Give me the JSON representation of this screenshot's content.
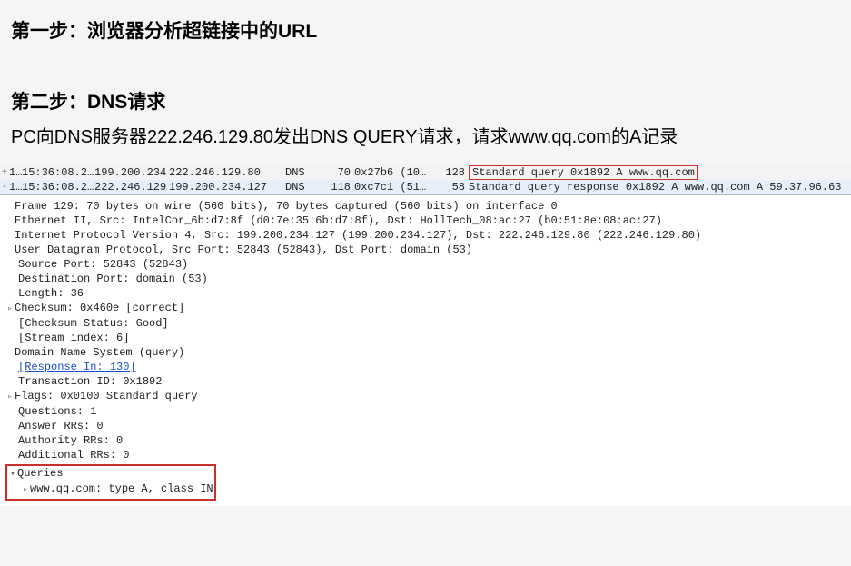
{
  "headings": {
    "step1": "第一步：浏览器分析超链接中的URL",
    "step2": "第二步：DNS请求"
  },
  "paragraph": "PC向DNS服务器222.246.129.80发出DNS QUERY请求，请求www.qq.com的A记录",
  "packet_list": {
    "rows": [
      {
        "expand": "+",
        "no": "1…",
        "time": "15:36:08.2…",
        "src": "199.200.234.…",
        "dst": "222.246.129.80",
        "proto": "DNS",
        "len": "70",
        "colA": "0x27b6 (10…",
        "colB": "128",
        "info": "Standard query 0x1892 A www.qq.com",
        "highlight": true
      },
      {
        "expand": "-",
        "no": "1…",
        "time": "15:36:08.2…",
        "src": "222.246.129.…",
        "dst": "199.200.234.127",
        "proto": "DNS",
        "len": "118",
        "colA": "0xc7c1 (51…",
        "colB": "58",
        "info": "Standard query response 0x1892 A www.qq.com A 59.37.96.63",
        "highlight": false
      }
    ]
  },
  "details": {
    "frame": "Frame 129: 70 bytes on wire (560 bits), 70 bytes captured (560 bits) on interface 0",
    "eth": "Ethernet II, Src: IntelCor_6b:d7:8f (d0:7e:35:6b:d7:8f), Dst: HollTech_08:ac:27 (b0:51:8e:08:ac:27)",
    "ip": "Internet Protocol Version 4, Src: 199.200.234.127 (199.200.234.127), Dst: 222.246.129.80 (222.246.129.80)",
    "udp": "User Datagram Protocol, Src Port: 52843 (52843), Dst Port: domain (53)",
    "udp_children": {
      "srcport": "Source Port: 52843 (52843)",
      "dstport": "Destination Port: domain (53)",
      "length": "Length: 36",
      "checksum": "Checksum: 0x460e [correct]",
      "checksum_status": "[Checksum Status: Good]",
      "stream": "[Stream index: 6]"
    },
    "dns": "Domain Name System (query)",
    "dns_children": {
      "response_in": "[Response In: 130]",
      "txid": "Transaction ID: 0x1892",
      "flags": "Flags: 0x0100 Standard query",
      "questions": "Questions: 1",
      "answer_rrs": "Answer RRs: 0",
      "authority_rrs": "Authority RRs: 0",
      "additional_rrs": "Additional RRs: 0",
      "queries_label": "Queries",
      "query_item": "www.qq.com: type A, class IN"
    }
  }
}
